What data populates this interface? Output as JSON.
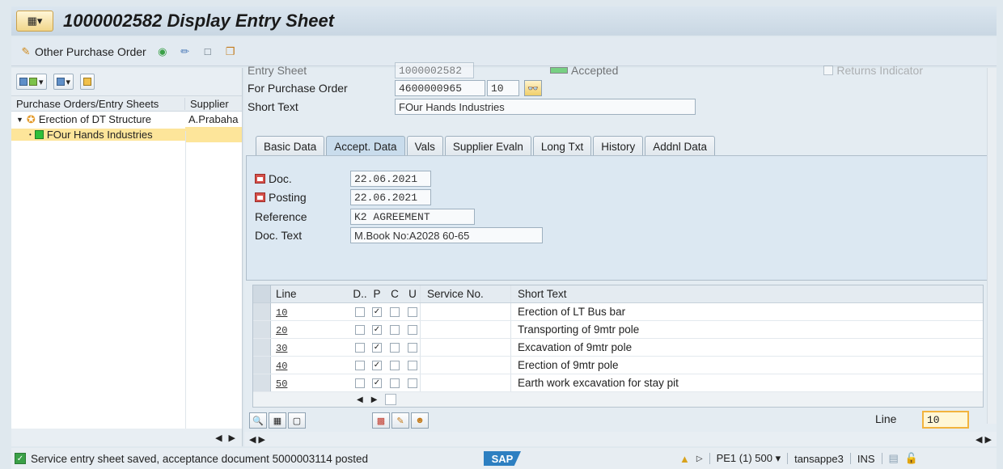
{
  "window": {
    "title": "1000002582 Display Entry Sheet"
  },
  "toolbar": {
    "other_po_label": "Other Purchase Order"
  },
  "tree": {
    "col_po": "Purchase Orders/Entry Sheets",
    "col_supplier": "Supplier",
    "rows": [
      {
        "label": "Erection of DT Structure",
        "supplier": "A.Prabaha"
      },
      {
        "label": "FOur Hands Industries",
        "supplier": ""
      }
    ]
  },
  "header": {
    "entry_sheet_label": "Entry Sheet",
    "entry_sheet_value": "1000002582",
    "status_text": "Accepted",
    "returns_indicator": "Returns Indicator",
    "po_label": "For Purchase Order",
    "po_number": "4600000965",
    "po_item": "10",
    "short_text_label": "Short Text",
    "short_text_value": "FOur Hands Industries"
  },
  "tabs": [
    "Basic Data",
    "Accept. Data",
    "Vals",
    "Supplier Evaln",
    "Long Txt",
    "History",
    "Addnl Data"
  ],
  "acceptance": {
    "doc_label": "Doc.",
    "doc_date": "22.06.2021",
    "posting_label": "Posting",
    "posting_date": "22.06.2021",
    "reference_label": "Reference",
    "reference_value": "K2 AGREEMENT",
    "doc_text_label": "Doc. Text",
    "doc_text_value": "M.Book No:A2028 60-65"
  },
  "table": {
    "headers": {
      "line": "Line",
      "d": "D..",
      "p": "P",
      "c": "C",
      "u": "U",
      "service_no": "Service No.",
      "short_text": "Short Text"
    },
    "rows": [
      {
        "line": "10",
        "p_checked": true,
        "short_text": "Erection of LT Bus bar"
      },
      {
        "line": "20",
        "p_checked": true,
        "short_text": "Transporting of 9mtr pole"
      },
      {
        "line": "30",
        "p_checked": true,
        "short_text": "Excavation of 9mtr pole"
      },
      {
        "line": "40",
        "p_checked": true,
        "short_text": "Erection of 9mtr pole"
      },
      {
        "line": "50",
        "p_checked": true,
        "short_text": "Earth work excavation for stay pit"
      }
    ]
  },
  "bottom": {
    "line_label": "Line",
    "line_value": "10"
  },
  "status": {
    "message": "Service entry sheet saved, acceptance document 5000003114 posted",
    "logo": "SAP",
    "system": "PE1 (1) 500",
    "user": "tansappe3",
    "mode": "INS"
  }
}
